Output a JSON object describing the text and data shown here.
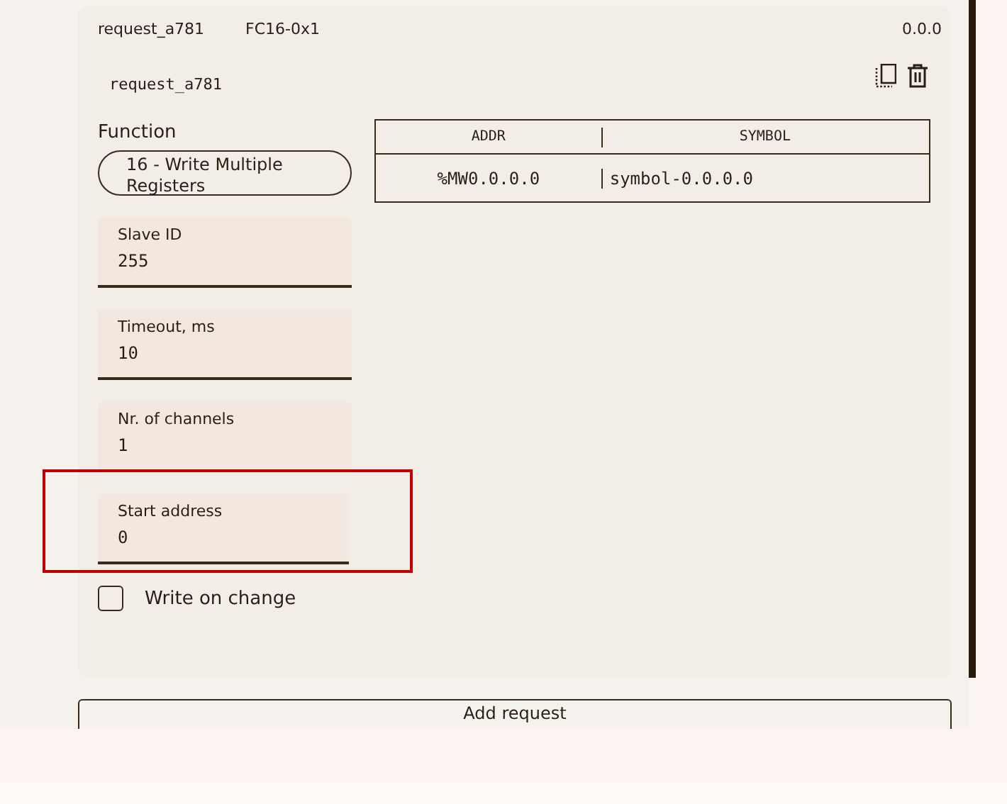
{
  "request": {
    "name": "request_a781",
    "code": "FC16-0x1",
    "version": "0.0.0",
    "title": "request_a781",
    "function": {
      "label": "Function",
      "value": "16 - Write Multiple Registers"
    },
    "table": {
      "columns": [
        "ADDR",
        "SYMBOL"
      ],
      "rows": [
        [
          "%MW0.0.0.0",
          "symbol-0.0.0.0"
        ]
      ]
    },
    "fields": [
      {
        "label": "Slave ID",
        "value": "255",
        "highlighted": false
      },
      {
        "label": "Timeout, ms",
        "value": "10",
        "highlighted": false
      },
      {
        "label": "Nr. of channels",
        "value": "1",
        "highlighted": false
      },
      {
        "label": "Start address",
        "value": "0",
        "highlighted": true
      }
    ],
    "write_on_change": {
      "label": "Write on change",
      "checked": false
    }
  },
  "add_button": "Add request"
}
